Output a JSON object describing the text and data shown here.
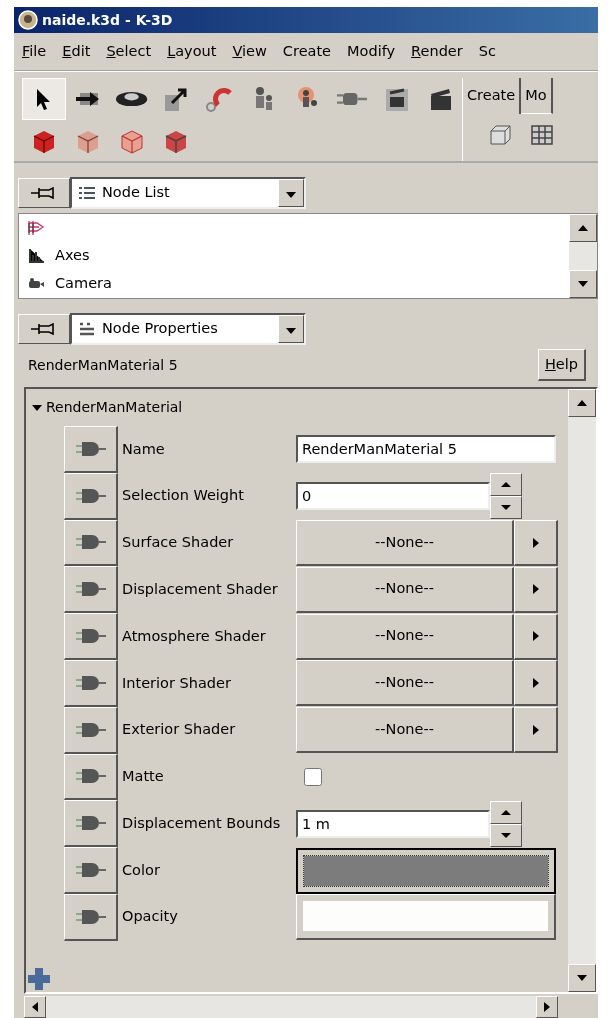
{
  "window": {
    "title": "naide.k3d - K-3D"
  },
  "menu": [
    {
      "label": "File",
      "mnemonic": true
    },
    {
      "label": "Edit",
      "mnemonic": true
    },
    {
      "label": "Select",
      "mnemonic": true
    },
    {
      "label": "Layout",
      "mnemonic": true
    },
    {
      "label": "View",
      "mnemonic": true
    },
    {
      "label": "Create",
      "mnemonic": false
    },
    {
      "label": "Modify",
      "mnemonic": false
    },
    {
      "label": "Render",
      "mnemonic": true
    },
    {
      "label": "Sc",
      "mnemonic": false
    }
  ],
  "toolbar": {
    "tools": [
      {
        "selected": true
      },
      {
        "selected": false
      },
      {
        "selected": false
      },
      {
        "selected": false
      },
      {
        "selected": false
      },
      {
        "selected": false
      },
      {
        "selected": false
      },
      {
        "selected": false
      },
      {
        "selected": false
      },
      {
        "selected": false
      }
    ],
    "tabs": [
      {
        "label": "Create",
        "selected": true
      },
      {
        "label": "Mo",
        "selected": false
      }
    ]
  },
  "node_list": {
    "selector": "Node List",
    "items": [
      {
        "kind": "layers"
      },
      {
        "kind": "axes",
        "label": "Axes"
      },
      {
        "kind": "camera",
        "label": "Camera"
      }
    ]
  },
  "node_properties": {
    "selector": "Node Properties",
    "node": "RenderManMaterial 5",
    "help": "Help",
    "group": {
      "title": "RenderManMaterial",
      "expanded": true,
      "properties": [
        {
          "label": "Name",
          "kind": "text",
          "value": "RenderManMaterial 5"
        },
        {
          "label": "Selection Weight",
          "kind": "spin",
          "value": "0"
        },
        {
          "label": "Surface Shader",
          "kind": "shader",
          "value": "--None--"
        },
        {
          "label": "Displacement Shader",
          "kind": "shader",
          "value": "--None--"
        },
        {
          "label": "Atmosphere Shader",
          "kind": "shader",
          "value": "--None--"
        },
        {
          "label": "Interior Shader",
          "kind": "shader",
          "value": "--None--"
        },
        {
          "label": "Exterior Shader",
          "kind": "shader",
          "value": "--None--"
        },
        {
          "label": "Matte",
          "kind": "checkbox",
          "checked": false
        },
        {
          "label": "Displacement Bounds",
          "kind": "spin",
          "value": "1 m"
        },
        {
          "label": "Color",
          "kind": "color",
          "color": "#7c7c7c"
        },
        {
          "label": "Opacity",
          "kind": "blank"
        }
      ]
    }
  }
}
